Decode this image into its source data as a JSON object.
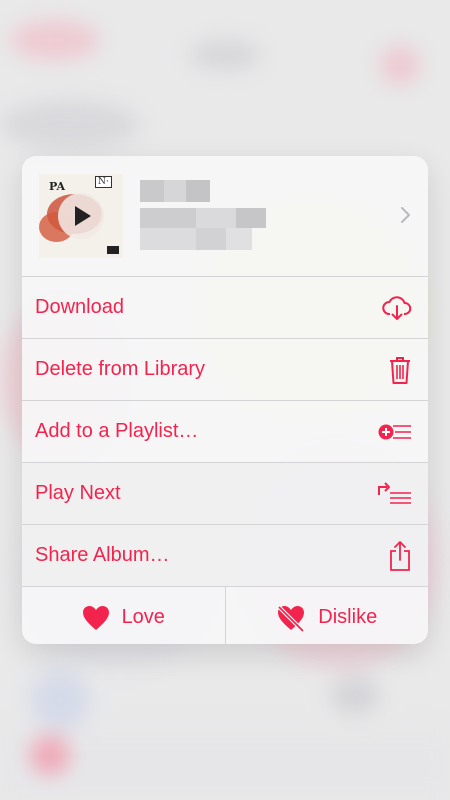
{
  "header": {
    "album_title": "",
    "album_artist": ""
  },
  "menu": {
    "items": [
      {
        "label": "Download",
        "icon": "cloud-download-icon"
      },
      {
        "label": "Delete from Library",
        "icon": "trash-icon"
      },
      {
        "label": "Add to a Playlist…",
        "icon": "add-to-playlist-icon"
      },
      {
        "label": "Play Next",
        "icon": "play-next-icon"
      },
      {
        "label": "Share Album…",
        "icon": "share-icon"
      }
    ],
    "love_label": "Love",
    "dislike_label": "Dislike"
  },
  "colors": {
    "accent": "#f2244e",
    "menu_bg": "#f6f6f7",
    "divider": "#d4d4d7"
  }
}
